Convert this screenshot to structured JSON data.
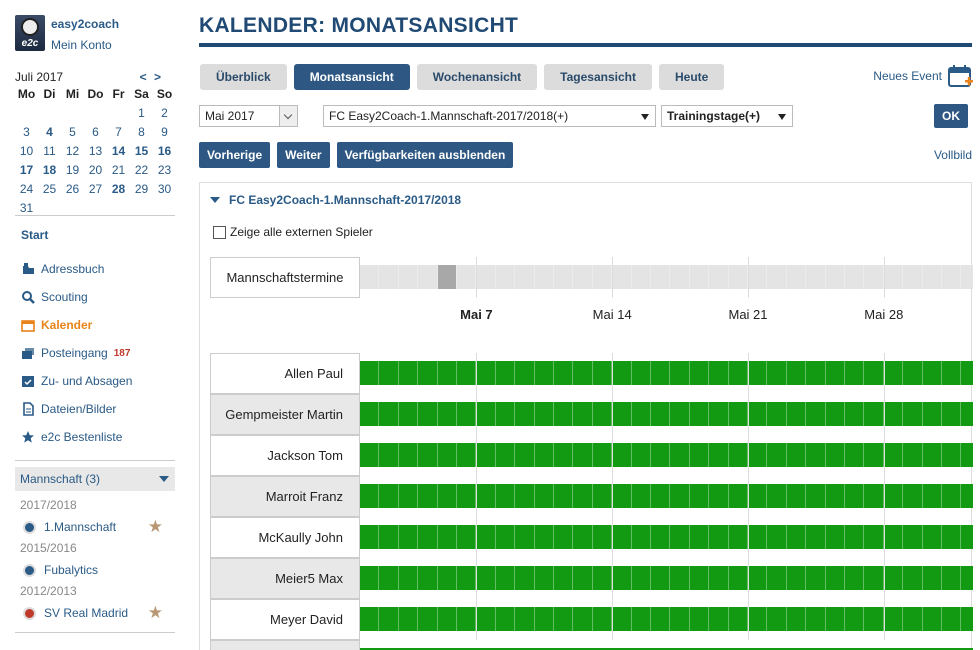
{
  "user": {
    "name": "easy2coach",
    "account": "Mein Konto",
    "avatar_text": "e2c"
  },
  "mini_calendar": {
    "month": "Juli 2017",
    "nav": "< >",
    "weekdays": [
      "Mo",
      "Di",
      "Mi",
      "Do",
      "Fr",
      "Sa",
      "So"
    ],
    "weeks": [
      [
        "",
        "",
        "",
        "",
        "",
        "1",
        "2"
      ],
      [
        "3",
        "4",
        "5",
        "6",
        "7",
        "8",
        "9"
      ],
      [
        "10",
        "11",
        "12",
        "13",
        "14",
        "15",
        "16"
      ],
      [
        "17",
        "18",
        "19",
        "20",
        "21",
        "22",
        "23"
      ],
      [
        "24",
        "25",
        "26",
        "27",
        "28",
        "29",
        "30"
      ],
      [
        "31",
        "",
        "",
        "",
        "",
        "",
        ""
      ]
    ],
    "bold_days": [
      "4",
      "14",
      "15",
      "16",
      "17",
      "18",
      "28"
    ]
  },
  "menu": {
    "start": "Start",
    "items": [
      {
        "label": "Adressbuch",
        "icon": "address-book-icon"
      },
      {
        "label": "Scouting",
        "icon": "search-icon"
      },
      {
        "label": "Kalender",
        "icon": "calendar-icon",
        "active": true
      },
      {
        "label": "Posteingang",
        "icon": "inbox-icon",
        "badge": "187"
      },
      {
        "label": "Zu- und Absagen",
        "icon": "calendar-check-icon"
      },
      {
        "label": "Dateien/Bilder",
        "icon": "file-icon"
      },
      {
        "label": "e2c Bestenliste",
        "icon": "star-icon"
      }
    ]
  },
  "teams": {
    "header": "Mannschaft (3)",
    "groups": [
      {
        "season": "2017/2018",
        "team": "1.Mannschaft",
        "starred": true,
        "icon_color": "#2a5a86"
      },
      {
        "season": "2015/2016",
        "team": "Fubalytics",
        "starred": false,
        "icon_color": "#2a5a86"
      },
      {
        "season": "2012/2013",
        "team": "SV Real Madrid",
        "starred": true,
        "icon_color": "#c0392b"
      }
    ]
  },
  "page": {
    "title": "KALENDER: MONATSANSICHT",
    "tabs": [
      "Überblick",
      "Monatsansicht",
      "Wochenansicht",
      "Tagesansicht",
      "Heute"
    ],
    "active_tab": "Monatsansicht",
    "new_event": "Neues Event",
    "month_select": "Mai 2017",
    "team_select": "FC Easy2Coach-1.Mannschaft-2017/2018(+)",
    "kind_select": "Trainingstage(+)",
    "ok": "OK",
    "buttons": [
      "Vorherige",
      "Weiter",
      "Verfügbarkeiten ausblenden"
    ],
    "fullscreen": "Vollbild"
  },
  "panel": {
    "title": "FC Easy2Coach-1.Mannschaft-2017/2018",
    "show_external": "Zeige alle externen Spieler",
    "team_row_label": "Mannschaftstermine",
    "week_labels": [
      {
        "label": "Mai 7",
        "bold": true
      },
      {
        "label": "Mai 14",
        "bold": false
      },
      {
        "label": "Mai 21",
        "bold": false
      },
      {
        "label": "Mai 28",
        "bold": false
      }
    ],
    "players": [
      "Allen Paul",
      "Gempmeister Martin",
      "Jackson Tom",
      "Marroit Franz",
      "McKaully John",
      "Meier5 Max",
      "Meyer David"
    ],
    "colors": {
      "available": "#129a12",
      "team_empty": "#e4e4e4",
      "team_event": "#a8a8a8"
    },
    "team_event_day_index": 4
  }
}
